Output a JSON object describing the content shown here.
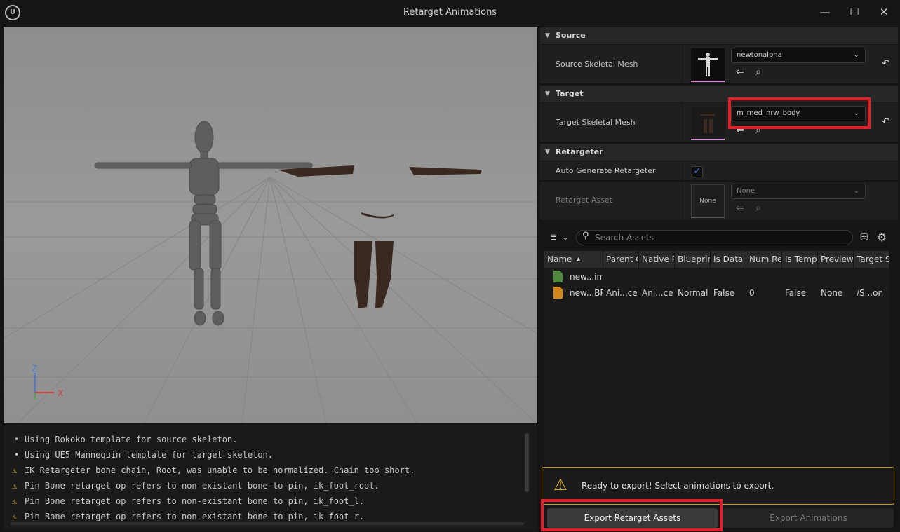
{
  "window": {
    "title": "Retarget Animations",
    "logo_text": "U",
    "min_glyph": "—",
    "max_glyph": "☐",
    "close_glyph": "✕"
  },
  "viewport": {
    "axis_z": "Z",
    "axis_x": "X"
  },
  "log": {
    "bullet": "•",
    "warning_glyph": "⚠",
    "lines": [
      {
        "type": "info",
        "text": "Using Rokoko template for source skeleton."
      },
      {
        "type": "info",
        "text": "Using UE5 Mannequin template for target skeleton."
      },
      {
        "type": "warning",
        "text": "IK Retargeter bone chain, Root, was unable to be normalized. Chain too short."
      },
      {
        "type": "warning",
        "text": "Pin Bone retarget op refers to non-existant bone to pin, ik_foot_root."
      },
      {
        "type": "warning",
        "text": "Pin Bone retarget op refers to non-existant bone to pin, ik_foot_l."
      },
      {
        "type": "warning",
        "text": "Pin Bone retarget op refers to non-existant bone to pin, ik_foot_r."
      }
    ]
  },
  "details": {
    "triangle_glyph": "▼",
    "chevron_glyph": "⌄",
    "reset_glyph": "↶",
    "check_glyph": "✓",
    "source": {
      "header": "Source",
      "label": "Source Skeletal Mesh",
      "value": "newtonalpha"
    },
    "target": {
      "header": "Target",
      "label": "Target Skeletal Mesh",
      "value": "m_med_nrw_body"
    },
    "retargeter": {
      "header": "Retargeter",
      "auto_label": "Auto Generate Retargeter",
      "auto_checked": true,
      "asset_label": "Retarget Asset",
      "asset_thumb": "None",
      "asset_value": "None"
    }
  },
  "asset_browser": {
    "search_placeholder": "Search Assets",
    "filter_glyph": "⩸",
    "chevron_glyph": "⌄",
    "search_glyph": "⚲",
    "folder_glyph": "⛁",
    "settings_glyph": "⚙",
    "sort_glyph": "▲",
    "columns": [
      "Name",
      "Parent C",
      "Native P",
      "Blueprin",
      "Is Data C",
      "Num Re",
      "Is Temp",
      "Preview",
      "Target S"
    ],
    "rows": [
      {
        "icon_color": "#4f8a3c",
        "cells": [
          "new...im",
          "",
          "",
          "",
          "",
          "",
          "",
          "",
          ""
        ]
      },
      {
        "icon_color": "#d4861c",
        "cells": [
          "new...BP",
          "Ani...ce",
          "Ani...ce",
          "Normal",
          "False",
          "0",
          "False",
          "None",
          "/S...on"
        ]
      }
    ]
  },
  "status": {
    "warning_glyph": "⚠",
    "message": "Ready to export! Select animations to export."
  },
  "buttons": {
    "export_assets": "Export Retarget Assets",
    "export_animations": "Export Animations"
  },
  "colors": {
    "highlight": "#e0202a",
    "accent_check": "#3f8ef5",
    "warning": "#f0c030",
    "thumb_underline": "#d68cd6"
  }
}
